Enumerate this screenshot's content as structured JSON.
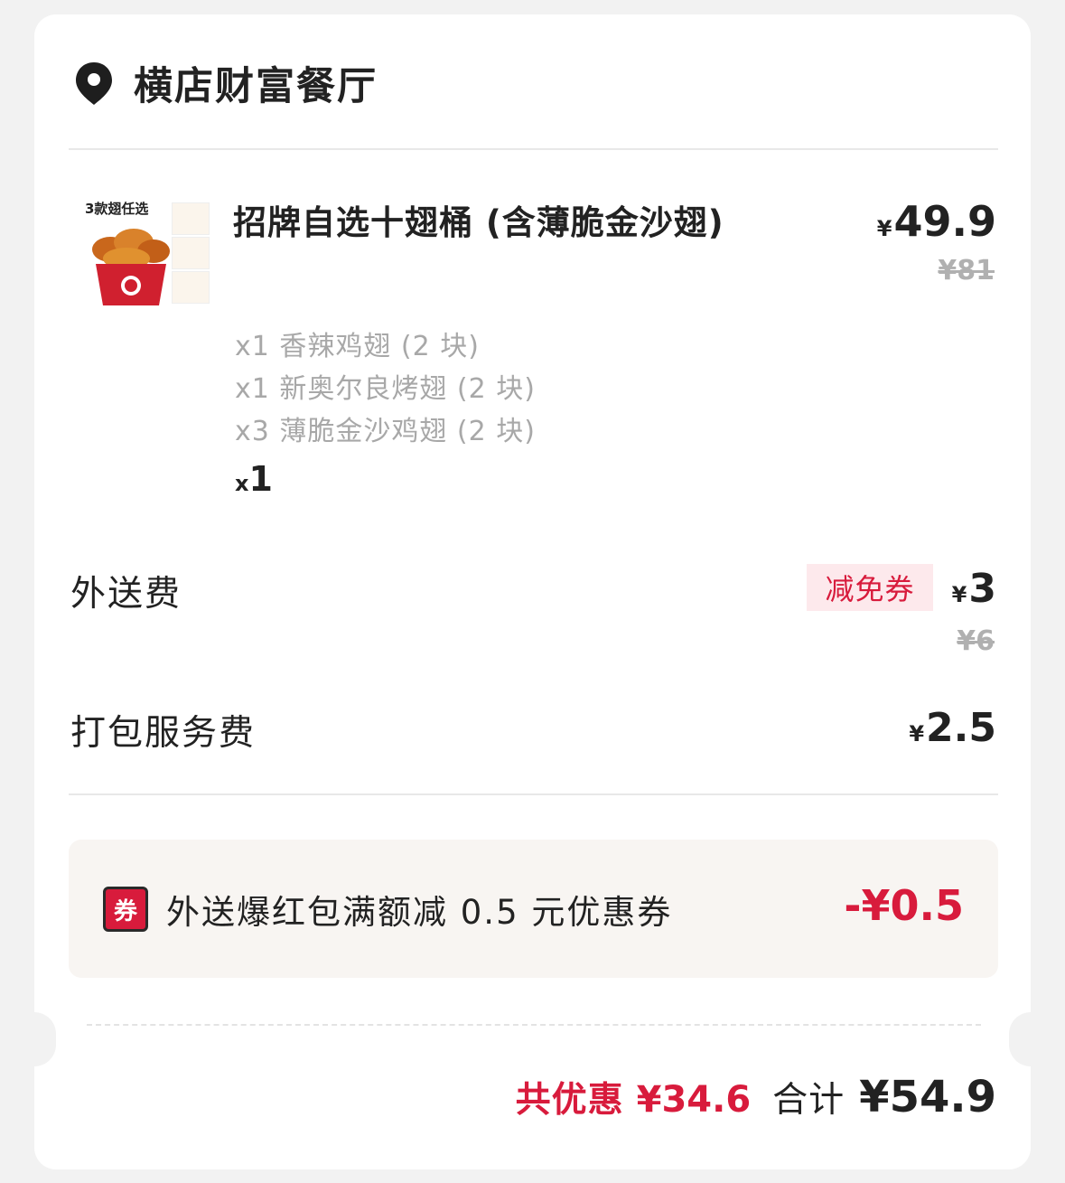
{
  "store": {
    "name": "横店财富餐厅",
    "icon": "location-pin-icon"
  },
  "item": {
    "image_title": "3款翅任选",
    "name": "招牌自选十翅桶 (含薄脆金沙翅)",
    "currency": "¥",
    "price": "49.9",
    "original_price": "¥81",
    "options": [
      "x1 香辣鸡翅 (2 块)",
      "x1 新奥尔良烤翅 (2 块)",
      "x3 薄脆金沙鸡翅 (2 块)"
    ],
    "qty_prefix": "x",
    "qty": "1"
  },
  "delivery": {
    "label": "外送费",
    "badge": "减免券",
    "currency": "¥",
    "price": "3",
    "original_price": "¥6"
  },
  "packing": {
    "label": "打包服务费",
    "currency": "¥",
    "price": "2.5"
  },
  "coupon": {
    "icon_text": "券",
    "text": "外送爆红包满额减 0.5 元优惠券",
    "amount": "-¥0.5"
  },
  "summary": {
    "saved_label": "共优惠",
    "saved_amount": "¥34.6",
    "total_label": "合计",
    "total_amount": "¥54.9"
  },
  "colors": {
    "accent": "#d81b3c",
    "muted": "#a8a8a8",
    "badge_bg": "#fde9ec",
    "coupon_bg": "#f8f5f2"
  }
}
